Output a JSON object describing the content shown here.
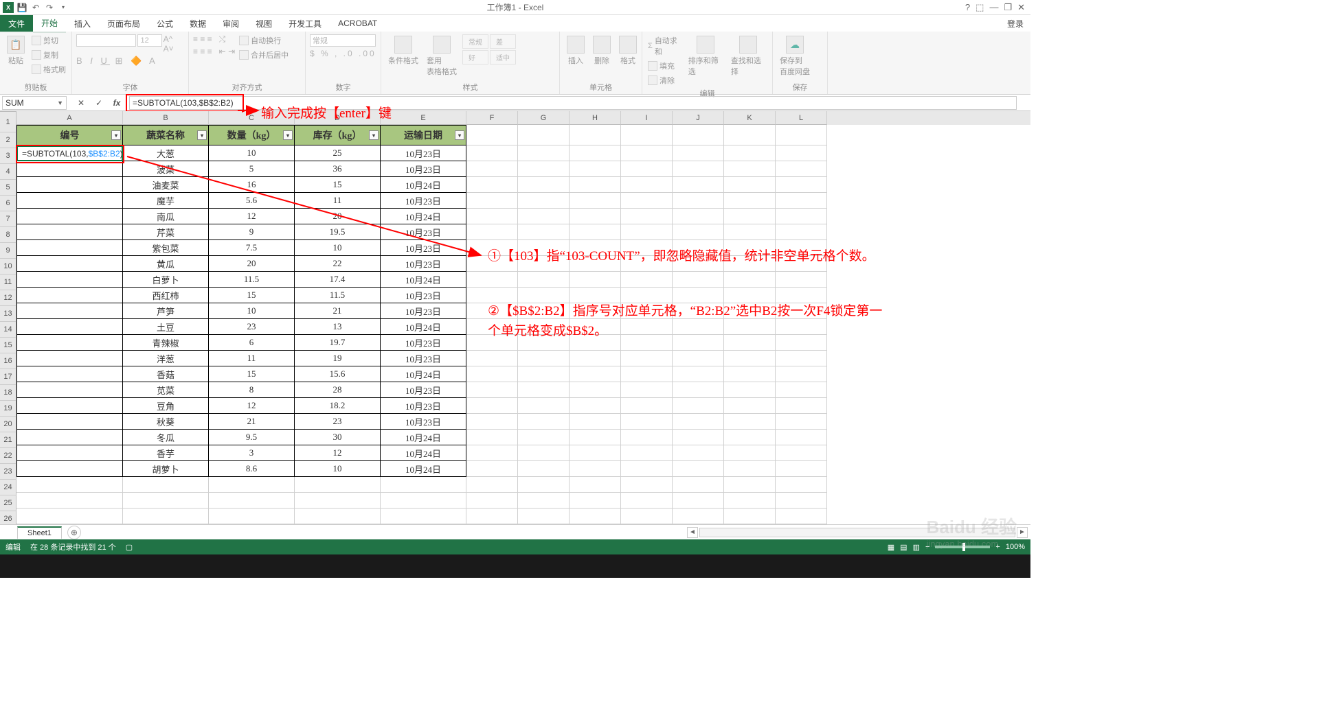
{
  "app": {
    "title": "工作簿1 - Excel",
    "login": "登录"
  },
  "qat": [
    "save",
    "undo",
    "redo"
  ],
  "wincontrols": [
    "?",
    "⬜",
    "—",
    "❐",
    "✕"
  ],
  "tabs": [
    "文件",
    "开始",
    "插入",
    "页面布局",
    "公式",
    "数据",
    "审阅",
    "视图",
    "开发工具",
    "ACROBAT"
  ],
  "ribbon_groups": {
    "clipboard": {
      "label": "剪贴板",
      "paste": "粘贴",
      "cut": "剪切",
      "copy": "复制",
      "brush": "格式刷"
    },
    "font": {
      "label": "字体",
      "size": "12"
    },
    "align": {
      "label": "对齐方式",
      "wrap": "自动换行",
      "merge": "合并后居中"
    },
    "number": {
      "label": "数字",
      "format": "常规"
    },
    "styles": {
      "label": "样式",
      "cond": "条件格式",
      "table": "套用\n表格格式",
      "good": "常规",
      "neutral": "好",
      "bad": "差",
      "calc": "适中"
    },
    "cells": {
      "label": "单元格",
      "insert": "插入",
      "delete": "删除",
      "format": "格式"
    },
    "editing": {
      "label": "编辑",
      "sum": "自动求和",
      "fill": "填充",
      "clear": "清除",
      "sort": "排序和筛选",
      "find": "查找和选择"
    },
    "save2": {
      "label": "保存",
      "cloud": "保存到\n百度网盘"
    }
  },
  "namebox": "SUM",
  "formula_display": "=SUBTOTAL(103,$B$2:B2)",
  "formula_plain": "=SUBTOTAL(103,",
  "formula_ref": "$B$2:B2",
  "formula_end": ")",
  "annotations": {
    "a1": "输入完成按【enter】键",
    "a2": "①【103】指“103-COUNT”，即忽略隐藏值，统计非空单元格个数。",
    "a3": "②【$B$2:B2】指序号对应单元格，“B2:B2”选中B2按一次F4锁定第一个单元格变成$B$2。"
  },
  "colheaders": [
    "A",
    "B",
    "C",
    "D",
    "E",
    "F",
    "G",
    "H",
    "I",
    "J",
    "K",
    "L"
  ],
  "table": {
    "headers": [
      "编号",
      "蔬菜名称",
      "数量（kg）",
      "库存（kg）",
      "运输日期"
    ],
    "editcell": "=SUBTOTAL(103,$B$2:B2)",
    "rows": [
      {
        "b": "大葱",
        "c": "10",
        "d": "25",
        "e": "10月23日"
      },
      {
        "b": "菠菜",
        "c": "5",
        "d": "36",
        "e": "10月23日"
      },
      {
        "b": "油麦菜",
        "c": "16",
        "d": "15",
        "e": "10月24日"
      },
      {
        "b": "魔芋",
        "c": "5.6",
        "d": "11",
        "e": "10月23日"
      },
      {
        "b": "南瓜",
        "c": "12",
        "d": "20",
        "e": "10月24日"
      },
      {
        "b": "芹菜",
        "c": "9",
        "d": "19.5",
        "e": "10月23日"
      },
      {
        "b": "紫包菜",
        "c": "7.5",
        "d": "10",
        "e": "10月23日"
      },
      {
        "b": "黄瓜",
        "c": "20",
        "d": "22",
        "e": "10月23日"
      },
      {
        "b": "白萝卜",
        "c": "11.5",
        "d": "17.4",
        "e": "10月24日"
      },
      {
        "b": "西红柿",
        "c": "15",
        "d": "11.5",
        "e": "10月23日"
      },
      {
        "b": "芦笋",
        "c": "10",
        "d": "21",
        "e": "10月23日"
      },
      {
        "b": "土豆",
        "c": "23",
        "d": "13",
        "e": "10月24日"
      },
      {
        "b": "青辣椒",
        "c": "6",
        "d": "19.7",
        "e": "10月23日"
      },
      {
        "b": "洋葱",
        "c": "11",
        "d": "19",
        "e": "10月23日"
      },
      {
        "b": "香菇",
        "c": "15",
        "d": "15.6",
        "e": "10月24日"
      },
      {
        "b": "苋菜",
        "c": "8",
        "d": "28",
        "e": "10月23日"
      },
      {
        "b": "豆角",
        "c": "12",
        "d": "18.2",
        "e": "10月23日"
      },
      {
        "b": "秋葵",
        "c": "21",
        "d": "23",
        "e": "10月23日"
      },
      {
        "b": "冬瓜",
        "c": "9.5",
        "d": "30",
        "e": "10月24日"
      },
      {
        "b": "香芋",
        "c": "3",
        "d": "12",
        "e": "10月24日"
      },
      {
        "b": "胡萝卜",
        "c": "8.6",
        "d": "10",
        "e": "10月24日"
      }
    ]
  },
  "sheet": {
    "name": "Sheet1"
  },
  "status": {
    "mode": "编辑",
    "found": "在 28 条记录中找到 21 个",
    "zoom": "100%"
  },
  "watermark": {
    "brand": "Baidu 经验",
    "url": "jingyan.baidu.com"
  }
}
